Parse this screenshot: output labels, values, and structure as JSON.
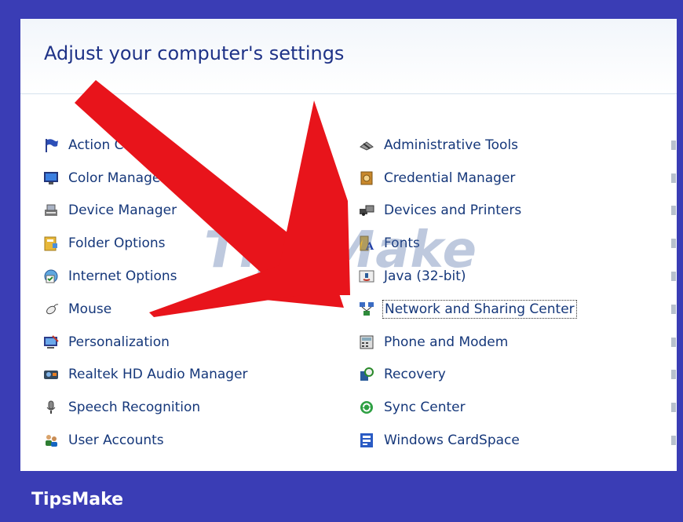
{
  "page_title": "Adjust your computer's settings",
  "left_items": [
    {
      "label": "Action Center",
      "icon": "flag-icon"
    },
    {
      "label": "Color Management",
      "icon": "monitor-color-icon"
    },
    {
      "label": "Device Manager",
      "icon": "device-manager-icon"
    },
    {
      "label": "Folder Options",
      "icon": "folder-options-icon"
    },
    {
      "label": "Internet Options",
      "icon": "internet-options-icon"
    },
    {
      "label": "Mouse",
      "icon": "mouse-icon"
    },
    {
      "label": "Personalization",
      "icon": "personalization-icon"
    },
    {
      "label": "Realtek HD Audio Manager",
      "icon": "audio-manager-icon"
    },
    {
      "label": "Speech Recognition",
      "icon": "microphone-icon"
    },
    {
      "label": "User Accounts",
      "icon": "user-accounts-icon"
    }
  ],
  "right_items": [
    {
      "label": "Administrative Tools",
      "icon": "admin-tools-icon"
    },
    {
      "label": "Credential Manager",
      "icon": "credential-manager-icon"
    },
    {
      "label": "Devices and Printers",
      "icon": "devices-printers-icon"
    },
    {
      "label": "Fonts",
      "icon": "fonts-icon"
    },
    {
      "label": "Java (32-bit)",
      "icon": "java-icon"
    },
    {
      "label": "Network and Sharing Center",
      "icon": "network-icon",
      "selected": true
    },
    {
      "label": "Phone and Modem",
      "icon": "phone-modem-icon"
    },
    {
      "label": "Recovery",
      "icon": "recovery-icon"
    },
    {
      "label": "Sync Center",
      "icon": "sync-center-icon"
    },
    {
      "label": "Windows CardSpace",
      "icon": "cardspace-icon"
    }
  ],
  "watermark": "TipsMake",
  "footer_brand": "TipsMake",
  "colors": {
    "border_blue": "#3a3db5",
    "link_text": "#15377a",
    "title_text": "#1e3287",
    "arrow_red": "#e8141b"
  }
}
